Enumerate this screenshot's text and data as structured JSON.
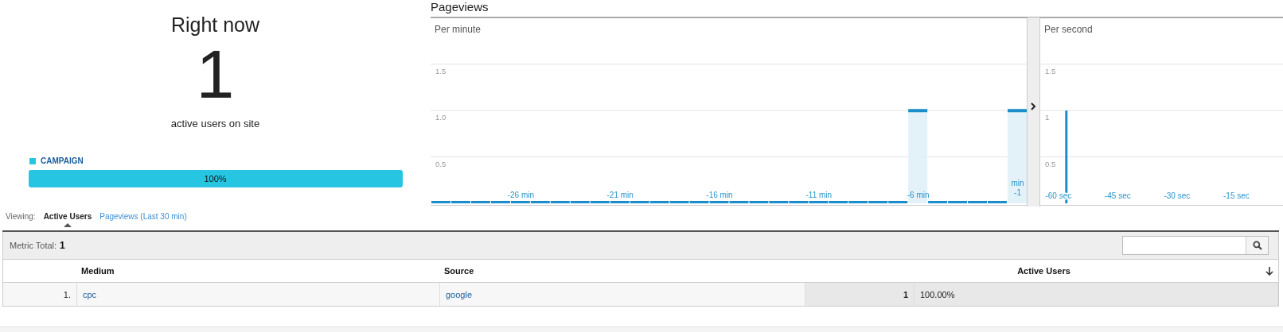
{
  "summary": {
    "title": "Right now",
    "count": "1",
    "caption": "active users on site"
  },
  "segments": [
    {
      "label": "CAMPAIGN",
      "color": "#26c6e3",
      "share": "100%"
    }
  ],
  "pageviews": {
    "title": "Pageviews",
    "per_minute": {
      "chart_data": {
        "type": "bar",
        "title": "Per minute",
        "x": [
          -30,
          -29,
          -28,
          -27,
          -26,
          -25,
          -24,
          -23,
          -22,
          -21,
          -20,
          -19,
          -18,
          -17,
          -16,
          -15,
          -14,
          -13,
          -12,
          -11,
          -10,
          -9,
          -8,
          -7,
          -6,
          -5,
          -4,
          -3,
          -2,
          -1
        ],
        "values": [
          0,
          0,
          0,
          0,
          0,
          0,
          0,
          0,
          0,
          0,
          0,
          0,
          0,
          0,
          0,
          0,
          0,
          0,
          0,
          0,
          0,
          0,
          0,
          0,
          1,
          0,
          0,
          0,
          0,
          1
        ],
        "xlim": [
          -30.5,
          -0.5
        ],
        "ylim": [
          0,
          2
        ],
        "grid": true,
        "yticks": [
          {
            "value": 0.5,
            "label": "0.5"
          },
          {
            "value": 1,
            "label": "1.0"
          },
          {
            "value": 1.5,
            "label": "1.5"
          }
        ],
        "xticks": [
          {
            "value": -26,
            "label": "-26 min"
          },
          {
            "value": -21,
            "label": "-21 min"
          },
          {
            "value": -16,
            "label": "-16 min"
          },
          {
            "value": -11,
            "label": "-11 min"
          },
          {
            "value": -6,
            "label": "-6 min"
          },
          {
            "value": -1,
            "label": "min -1"
          }
        ]
      }
    },
    "per_second": {
      "chart_data": {
        "type": "bar",
        "title": "Per second",
        "x": [
          -58
        ],
        "values": [
          1
        ],
        "xlim": [
          -64.6,
          -3.2
        ],
        "ylim": [
          0,
          2
        ],
        "grid": true,
        "yticks": [
          {
            "value": 0.5,
            "label": "0.5"
          },
          {
            "value": 1,
            "label": "1"
          },
          {
            "value": 1.5,
            "label": "1.5"
          }
        ],
        "xticks": [
          {
            "value": -60,
            "label": "-60 sec"
          },
          {
            "value": -45,
            "label": "-45 sec"
          },
          {
            "value": -30,
            "label": "-30 sec"
          },
          {
            "value": -15,
            "label": "-15 sec"
          }
        ]
      }
    }
  },
  "viewing": {
    "label": "Viewing:",
    "tabs": [
      {
        "label": "Active Users",
        "selected": true
      },
      {
        "label": "Pageviews (Last 30 min)",
        "selected": false
      }
    ]
  },
  "table": {
    "metric_total_label": "Metric Total:",
    "metric_total": "1",
    "columns": [
      "Medium",
      "Source",
      "Active Users"
    ],
    "rows": [
      {
        "index": "1.",
        "medium": "cpc",
        "source": "google",
        "active_users": "1",
        "share": "100.00%"
      }
    ]
  }
}
